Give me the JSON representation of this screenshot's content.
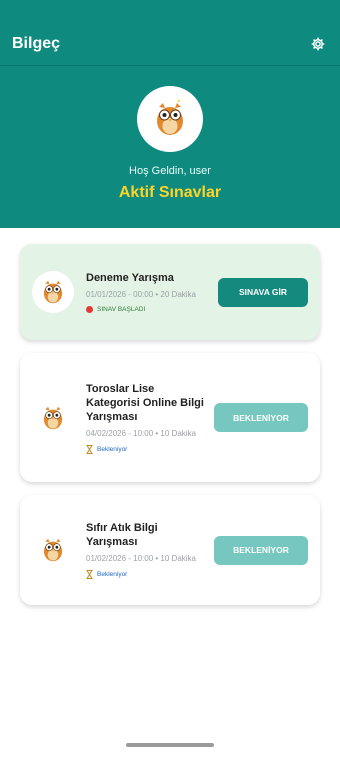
{
  "app": {
    "title": "Bilgeç"
  },
  "hero": {
    "welcome": "Hoş Geldin, user",
    "title": "Aktif Sınavlar"
  },
  "cards": [
    {
      "name": "Deneme Yarışma",
      "meta": "01/01/2026 - 00:00 • 20 Dakika",
      "status": "SINAV BAŞLADI",
      "button": "SINAVA GİR",
      "state": "active"
    },
    {
      "name": "Toroslar Lise Kategorisi Online Bilgi Yarışması",
      "meta": "04/02/2026 - 10:00 • 10 Dakika",
      "status": "Bekleniyor",
      "button": "BEKLENİYOR",
      "state": "pending"
    },
    {
      "name": "Sıfır Atık Bilgi Yarışması",
      "meta": "01/02/2026 - 10:00 • 10 Dakika",
      "status": "Bekleniyor",
      "button": "BEKLENİYOR",
      "state": "pending"
    }
  ],
  "colors": {
    "primary": "#0f8a7e",
    "accent": "#ffd428",
    "active_card": "#e3f3e6",
    "disabled_button": "#76c7bf"
  },
  "icons": {
    "settings": "gear-icon",
    "logo": "owl-icon",
    "hourglass": "hourglass-icon",
    "live": "red-dot-icon"
  }
}
